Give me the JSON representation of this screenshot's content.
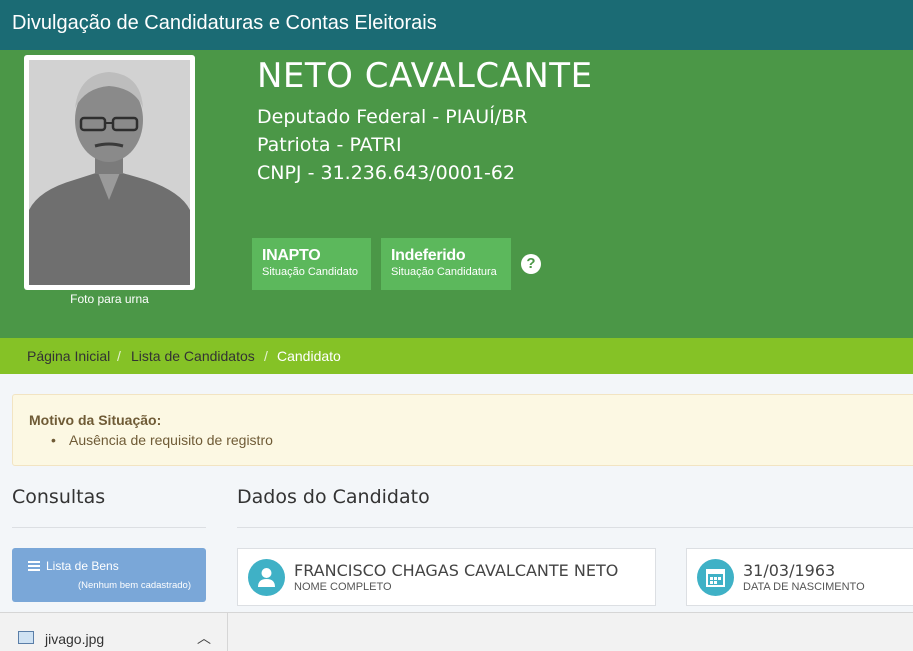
{
  "header": {
    "title": "Divulgação de Candidaturas e Contas Eleitorais"
  },
  "candidate": {
    "photo_caption": "Foto para urna",
    "name": "NETO CAVALCANTE",
    "office": "Deputado Federal - PIAUÍ/BR",
    "party": "Patriota - PATRI",
    "cnpj": "CNPJ - 31.236.643/0001-62",
    "status": [
      {
        "value": "INAPTO",
        "label": "Situação Candidato"
      },
      {
        "value": "Indeferido",
        "label": "Situação Candidatura"
      }
    ],
    "help_icon": "question-circle-icon",
    "help_symbol": "?"
  },
  "breadcrumb": {
    "home": "Página Inicial",
    "list": "Lista de Candidatos",
    "current": "Candidato",
    "separator": "/"
  },
  "alert": {
    "heading": "Motivo da Situação:",
    "items": [
      "Ausência de requisito de registro"
    ]
  },
  "consultas": {
    "title": "Consultas",
    "bens_button": {
      "label": "Lista de Bens",
      "sub": "(Nenhum bem cadastrado)"
    }
  },
  "dados": {
    "title": "Dados do Candidato",
    "cards": [
      {
        "icon": "user-icon",
        "value": "FRANCISCO CHAGAS CAVALCANTE NETO",
        "label": "NOME COMPLETO"
      },
      {
        "icon": "calendar-icon",
        "value": "31/03/1963",
        "label": "DATA DE NASCIMENTO"
      }
    ]
  },
  "download_bar": {
    "file_name": "jivago.jpg"
  },
  "colors": {
    "topbar": "#1b6b74",
    "hero": "#4b9747",
    "breadcrumb": "#85c226",
    "status_box": "#5cb85c",
    "icon_circle": "#3fb1c6"
  }
}
